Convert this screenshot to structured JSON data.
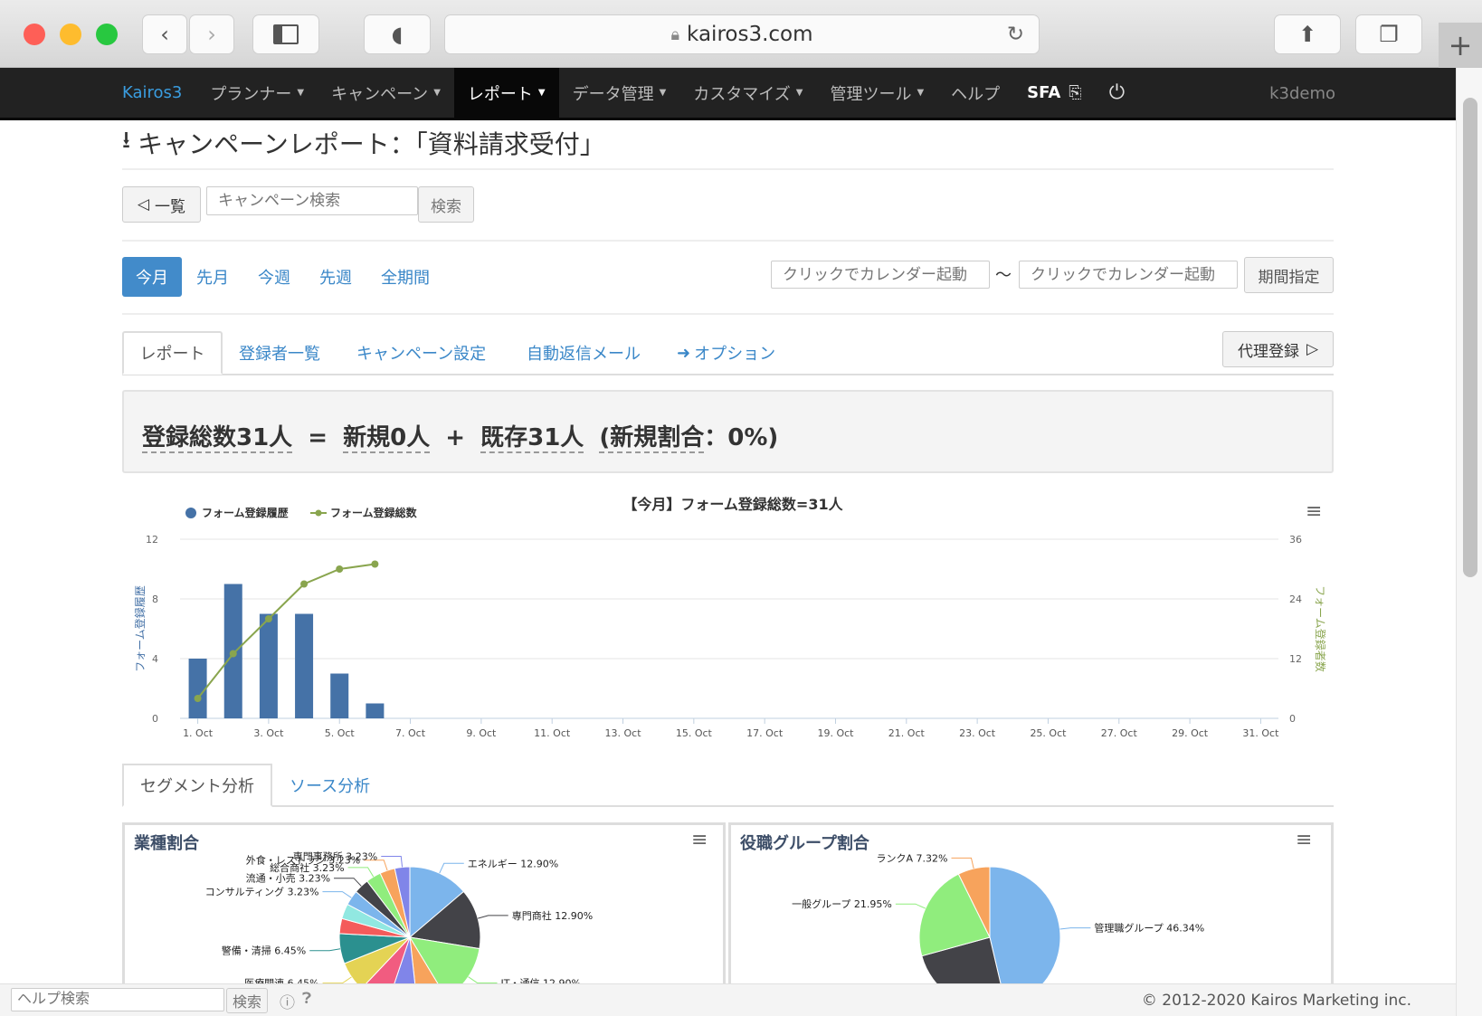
{
  "browser": {
    "url": "kairos3.com"
  },
  "nav": {
    "brand": "Kairos3",
    "items": [
      {
        "label": "プランナー",
        "caret": true
      },
      {
        "label": "キャンペーン",
        "caret": true
      },
      {
        "label": "レポート",
        "caret": true,
        "active": true
      },
      {
        "label": "データ管理",
        "caret": true
      },
      {
        "label": "カスタマイズ",
        "caret": true
      },
      {
        "label": "管理ツール",
        "caret": true
      },
      {
        "label": "ヘルプ",
        "caret": false
      },
      {
        "label": "SFA",
        "caret": false
      }
    ],
    "user": "k3demo"
  },
  "page": {
    "title": "キャンペーンレポート：「資料請求受付」",
    "back_label": "一覧",
    "search_placeholder": "キャンペーン検索",
    "search_button": "検索"
  },
  "period": {
    "items": [
      "今月",
      "先月",
      "今週",
      "先週",
      "全期間"
    ],
    "active": 0,
    "from_placeholder": "クリックでカレンダー起動",
    "separator": "〜",
    "to_placeholder": "クリックでカレンダー起動",
    "apply": "期間指定"
  },
  "tabs": {
    "items": [
      "レポート",
      "登録者一覧",
      "キャンペーン設定",
      "自動返信メール",
      "オプション"
    ],
    "active": 0,
    "proxy_button": "代理登録"
  },
  "summary": {
    "total": "登録総数31人",
    "eq": "=",
    "new": "新規0人",
    "plus": "+",
    "existing": "既存31人",
    "ratio_label": "(新規割合",
    "ratio_value": "：0%)"
  },
  "chart_data": [
    {
      "type": "bar+line",
      "title": "【今月】フォーム登録総数=31人",
      "x": [
        "1. Oct",
        "2. Oct",
        "3. Oct",
        "4. Oct",
        "5. Oct",
        "6. Oct",
        "7. Oct",
        "8. Oct",
        "9. Oct",
        "10. Oct",
        "11. Oct",
        "12. Oct",
        "13. Oct",
        "14. Oct",
        "15. Oct",
        "16. Oct",
        "17. Oct",
        "18. Oct",
        "19. Oct",
        "20. Oct",
        "21. Oct",
        "22. Oct",
        "23. Oct",
        "24. Oct",
        "25. Oct",
        "26. Oct",
        "27. Oct",
        "28. Oct",
        "29. Oct",
        "30. Oct",
        "31. Oct"
      ],
      "xticks": [
        "1. Oct",
        "3. Oct",
        "5. Oct",
        "7. Oct",
        "9. Oct",
        "11. Oct",
        "13. Oct",
        "15. Oct",
        "17. Oct",
        "19. Oct",
        "21. Oct",
        "23. Oct",
        "25. Oct",
        "27. Oct",
        "29. Oct",
        "31. Oct"
      ],
      "series": [
        {
          "name": "フォーム登録履歴",
          "type": "bar",
          "axis": "left",
          "color": "#4572a7",
          "values": [
            4,
            9,
            7,
            7,
            3,
            1
          ]
        },
        {
          "name": "フォーム登録総数",
          "type": "line",
          "axis": "right",
          "color": "#89a54e",
          "values": [
            4,
            13,
            20,
            27,
            30,
            31
          ]
        }
      ],
      "ylabel_left": "フォーム登録履歴",
      "ylabel_right": "フォーム登録者数",
      "ylim_left": [
        0,
        12
      ],
      "yticks_left": [
        0,
        4,
        8,
        12
      ],
      "ylim_right": [
        0,
        36
      ],
      "yticks_right": [
        0,
        12,
        24,
        36
      ],
      "grid": true,
      "legend": "top-left"
    },
    {
      "type": "pie",
      "title": "業種割合",
      "slices": [
        {
          "name": "エネルギー",
          "label": "エネルギー 12.90%",
          "value": 12.9,
          "color": "#7cb5ec"
        },
        {
          "name": "専門商社",
          "label": "専門商社 12.90%",
          "value": 12.9,
          "color": "#434348"
        },
        {
          "name": "IT・通信",
          "label": "IT・通信 12.90%",
          "value": 12.9,
          "color": "#90ed7d"
        },
        {
          "name": "",
          "label": "",
          "value": 6.45,
          "color": "#f7a35c"
        },
        {
          "name": "",
          "label": "",
          "value": 6.45,
          "color": "#8085e9"
        },
        {
          "name": "",
          "label": "",
          "value": 6.45,
          "color": "#f15c80"
        },
        {
          "name": "医療関連",
          "label": "医療関連 6.45%",
          "value": 6.45,
          "color": "#e4d354"
        },
        {
          "name": "警備・清掃",
          "label": "警備・清掃 6.45%",
          "value": 6.45,
          "color": "#2b908f"
        },
        {
          "name": "",
          "label": "",
          "value": 3.23,
          "color": "#f45b5b"
        },
        {
          "name": "",
          "label": "",
          "value": 3.23,
          "color": "#91e8e1"
        },
        {
          "name": "コンサルティング",
          "label": "コンサルティング 3.23%",
          "value": 3.23,
          "color": "#7cb5ec"
        },
        {
          "name": "流通・小売",
          "label": "流通・小売 3.23%",
          "value": 3.23,
          "color": "#434348"
        },
        {
          "name": "総合商社",
          "label": "総合商社 3.23%",
          "value": 3.23,
          "color": "#90ed7d"
        },
        {
          "name": "外食・レストラン",
          "label": "外食・レストラン 3.23%",
          "value": 3.23,
          "color": "#f7a35c"
        },
        {
          "name": "専門事務所",
          "label": "専門事務所 3.23%",
          "value": 3.23,
          "color": "#8085e9"
        }
      ]
    },
    {
      "type": "pie",
      "title": "役職グループ割合",
      "slices": [
        {
          "name": "管理職グループ",
          "label": "管理職グループ 46.34%",
          "value": 46.34,
          "color": "#7cb5ec"
        },
        {
          "name": "",
          "label": "",
          "value": 24.39,
          "color": "#434348"
        },
        {
          "name": "一般グループ",
          "label": "一般グループ 21.95%",
          "value": 21.95,
          "color": "#90ed7d"
        },
        {
          "name": "ランクA",
          "label": "ランクA 7.32%",
          "value": 7.32,
          "color": "#f7a35c"
        }
      ]
    }
  ],
  "analysis_tabs": {
    "items": [
      "セグメント分析",
      "ソース分析"
    ],
    "active": 0
  },
  "footer": {
    "help_placeholder": "ヘルプ検索",
    "help_button": "検索",
    "copyright": "© 2012-2020 Kairos Marketing inc."
  }
}
